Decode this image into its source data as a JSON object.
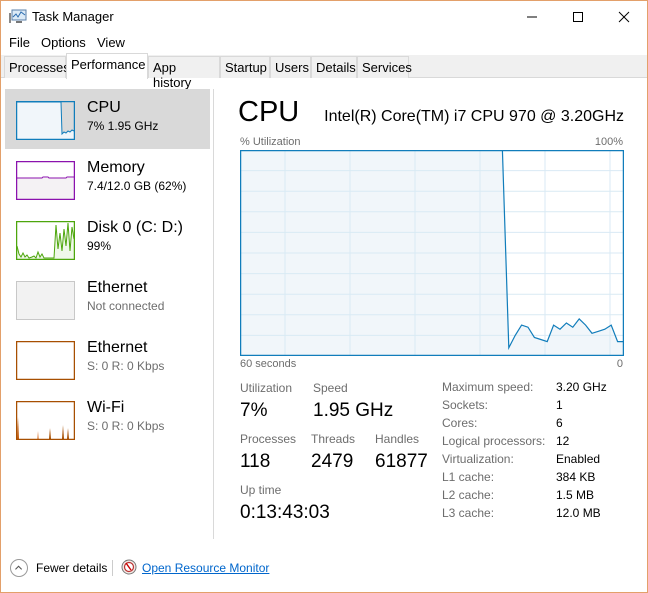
{
  "window": {
    "title": "Task Manager",
    "controls": {
      "minimize": "—",
      "maximize": "☐",
      "close": "✕"
    }
  },
  "menu": [
    "File",
    "Options",
    "View"
  ],
  "tabs": [
    {
      "label": "Processes",
      "active": false
    },
    {
      "label": "Performance",
      "active": true
    },
    {
      "label": "App history",
      "active": false
    },
    {
      "label": "Startup",
      "active": false
    },
    {
      "label": "Users",
      "active": false
    },
    {
      "label": "Details",
      "active": false
    },
    {
      "label": "Services",
      "active": false
    }
  ],
  "sidebar": {
    "items": [
      {
        "name": "CPU",
        "sub": "7%  1.95 GHz",
        "color": "#117dbb",
        "fill": "#f1f6fa",
        "selected": true
      },
      {
        "name": "Memory",
        "sub": "7.4/12.0 GB (62%)",
        "color": "#8b12ae",
        "fill": "#f4f2f4",
        "selected": false
      },
      {
        "name": "Disk 0 (C: D:)",
        "sub": "99%",
        "color": "#4da60c",
        "fill": "#eff7e9",
        "selected": false
      },
      {
        "name": "Ethernet",
        "sub": "Not connected",
        "color": "#c8c8c8",
        "fill": "#f2f2f2",
        "selected": false
      },
      {
        "name": "Ethernet",
        "sub": "S: 0  R: 0 Kbps",
        "color": "#a74f01",
        "fill": "#ffffff",
        "selected": false
      },
      {
        "name": "Wi-Fi",
        "sub": "S: 0  R: 0 Kbps",
        "color": "#a74f01",
        "fill": "#ffffff",
        "selected": false
      }
    ]
  },
  "main": {
    "title": "CPU",
    "model": "Intel(R) Core(TM) i7 CPU 970 @ 3.20GHz",
    "graph_label_top_left": "% Utilization",
    "graph_label_top_right": "100%",
    "graph_label_bottom_left": "60 seconds",
    "graph_label_bottom_right": "0",
    "stats": {
      "utilization_label": "Utilization",
      "utilization": "7%",
      "speed_label": "Speed",
      "speed": "1.95 GHz",
      "processes_label": "Processes",
      "processes": "118",
      "threads_label": "Threads",
      "threads": "2479",
      "handles_label": "Handles",
      "handles": "61877",
      "uptime_label": "Up time",
      "uptime": "0:13:43:03"
    },
    "details": [
      {
        "label": "Maximum speed:",
        "value": "3.20 GHz"
      },
      {
        "label": "Sockets:",
        "value": "1"
      },
      {
        "label": "Cores:",
        "value": "6"
      },
      {
        "label": "Logical processors:",
        "value": "12"
      },
      {
        "label": "Virtualization:",
        "value": "Enabled"
      },
      {
        "label": "L1 cache:",
        "value": "384 KB"
      },
      {
        "label": "L2 cache:",
        "value": "1.5 MB"
      },
      {
        "label": "L3 cache:",
        "value": "12.0 MB"
      }
    ]
  },
  "footer": {
    "fewer_details": "Fewer details",
    "resource_monitor": "Open Resource Monitor"
  },
  "chart_data": {
    "type": "area",
    "title": "% Utilization",
    "xlabel": "60 seconds",
    "ylabel": "% Utilization",
    "xlim": [
      60,
      0
    ],
    "ylim": [
      0,
      100
    ],
    "grid": true,
    "series": [
      {
        "name": "CPU",
        "color": "#117dbb",
        "fill": "#f1f6fa",
        "x": [
          60,
          59,
          58,
          57,
          56,
          55,
          54,
          53,
          52,
          51,
          50,
          49,
          48,
          47,
          46,
          45,
          44,
          43,
          42,
          41,
          40,
          39,
          38,
          37,
          36,
          35,
          34,
          33,
          32,
          31,
          30,
          29,
          28,
          27,
          26,
          25,
          24,
          23,
          22,
          21,
          20,
          19,
          18,
          17,
          16,
          15,
          14,
          13,
          12,
          11,
          10,
          9,
          8,
          7,
          6,
          5,
          4,
          3,
          2,
          1,
          0
        ],
        "values": [
          100,
          100,
          100,
          100,
          100,
          100,
          100,
          100,
          100,
          100,
          100,
          100,
          100,
          100,
          100,
          100,
          100,
          100,
          100,
          100,
          100,
          100,
          100,
          100,
          100,
          100,
          100,
          100,
          100,
          100,
          100,
          100,
          100,
          100,
          100,
          100,
          100,
          100,
          100,
          100,
          100,
          100,
          4,
          10,
          15,
          14,
          9,
          8,
          7,
          15,
          13,
          16,
          14,
          18,
          15,
          11,
          12,
          13,
          15,
          7,
          7
        ]
      }
    ]
  }
}
